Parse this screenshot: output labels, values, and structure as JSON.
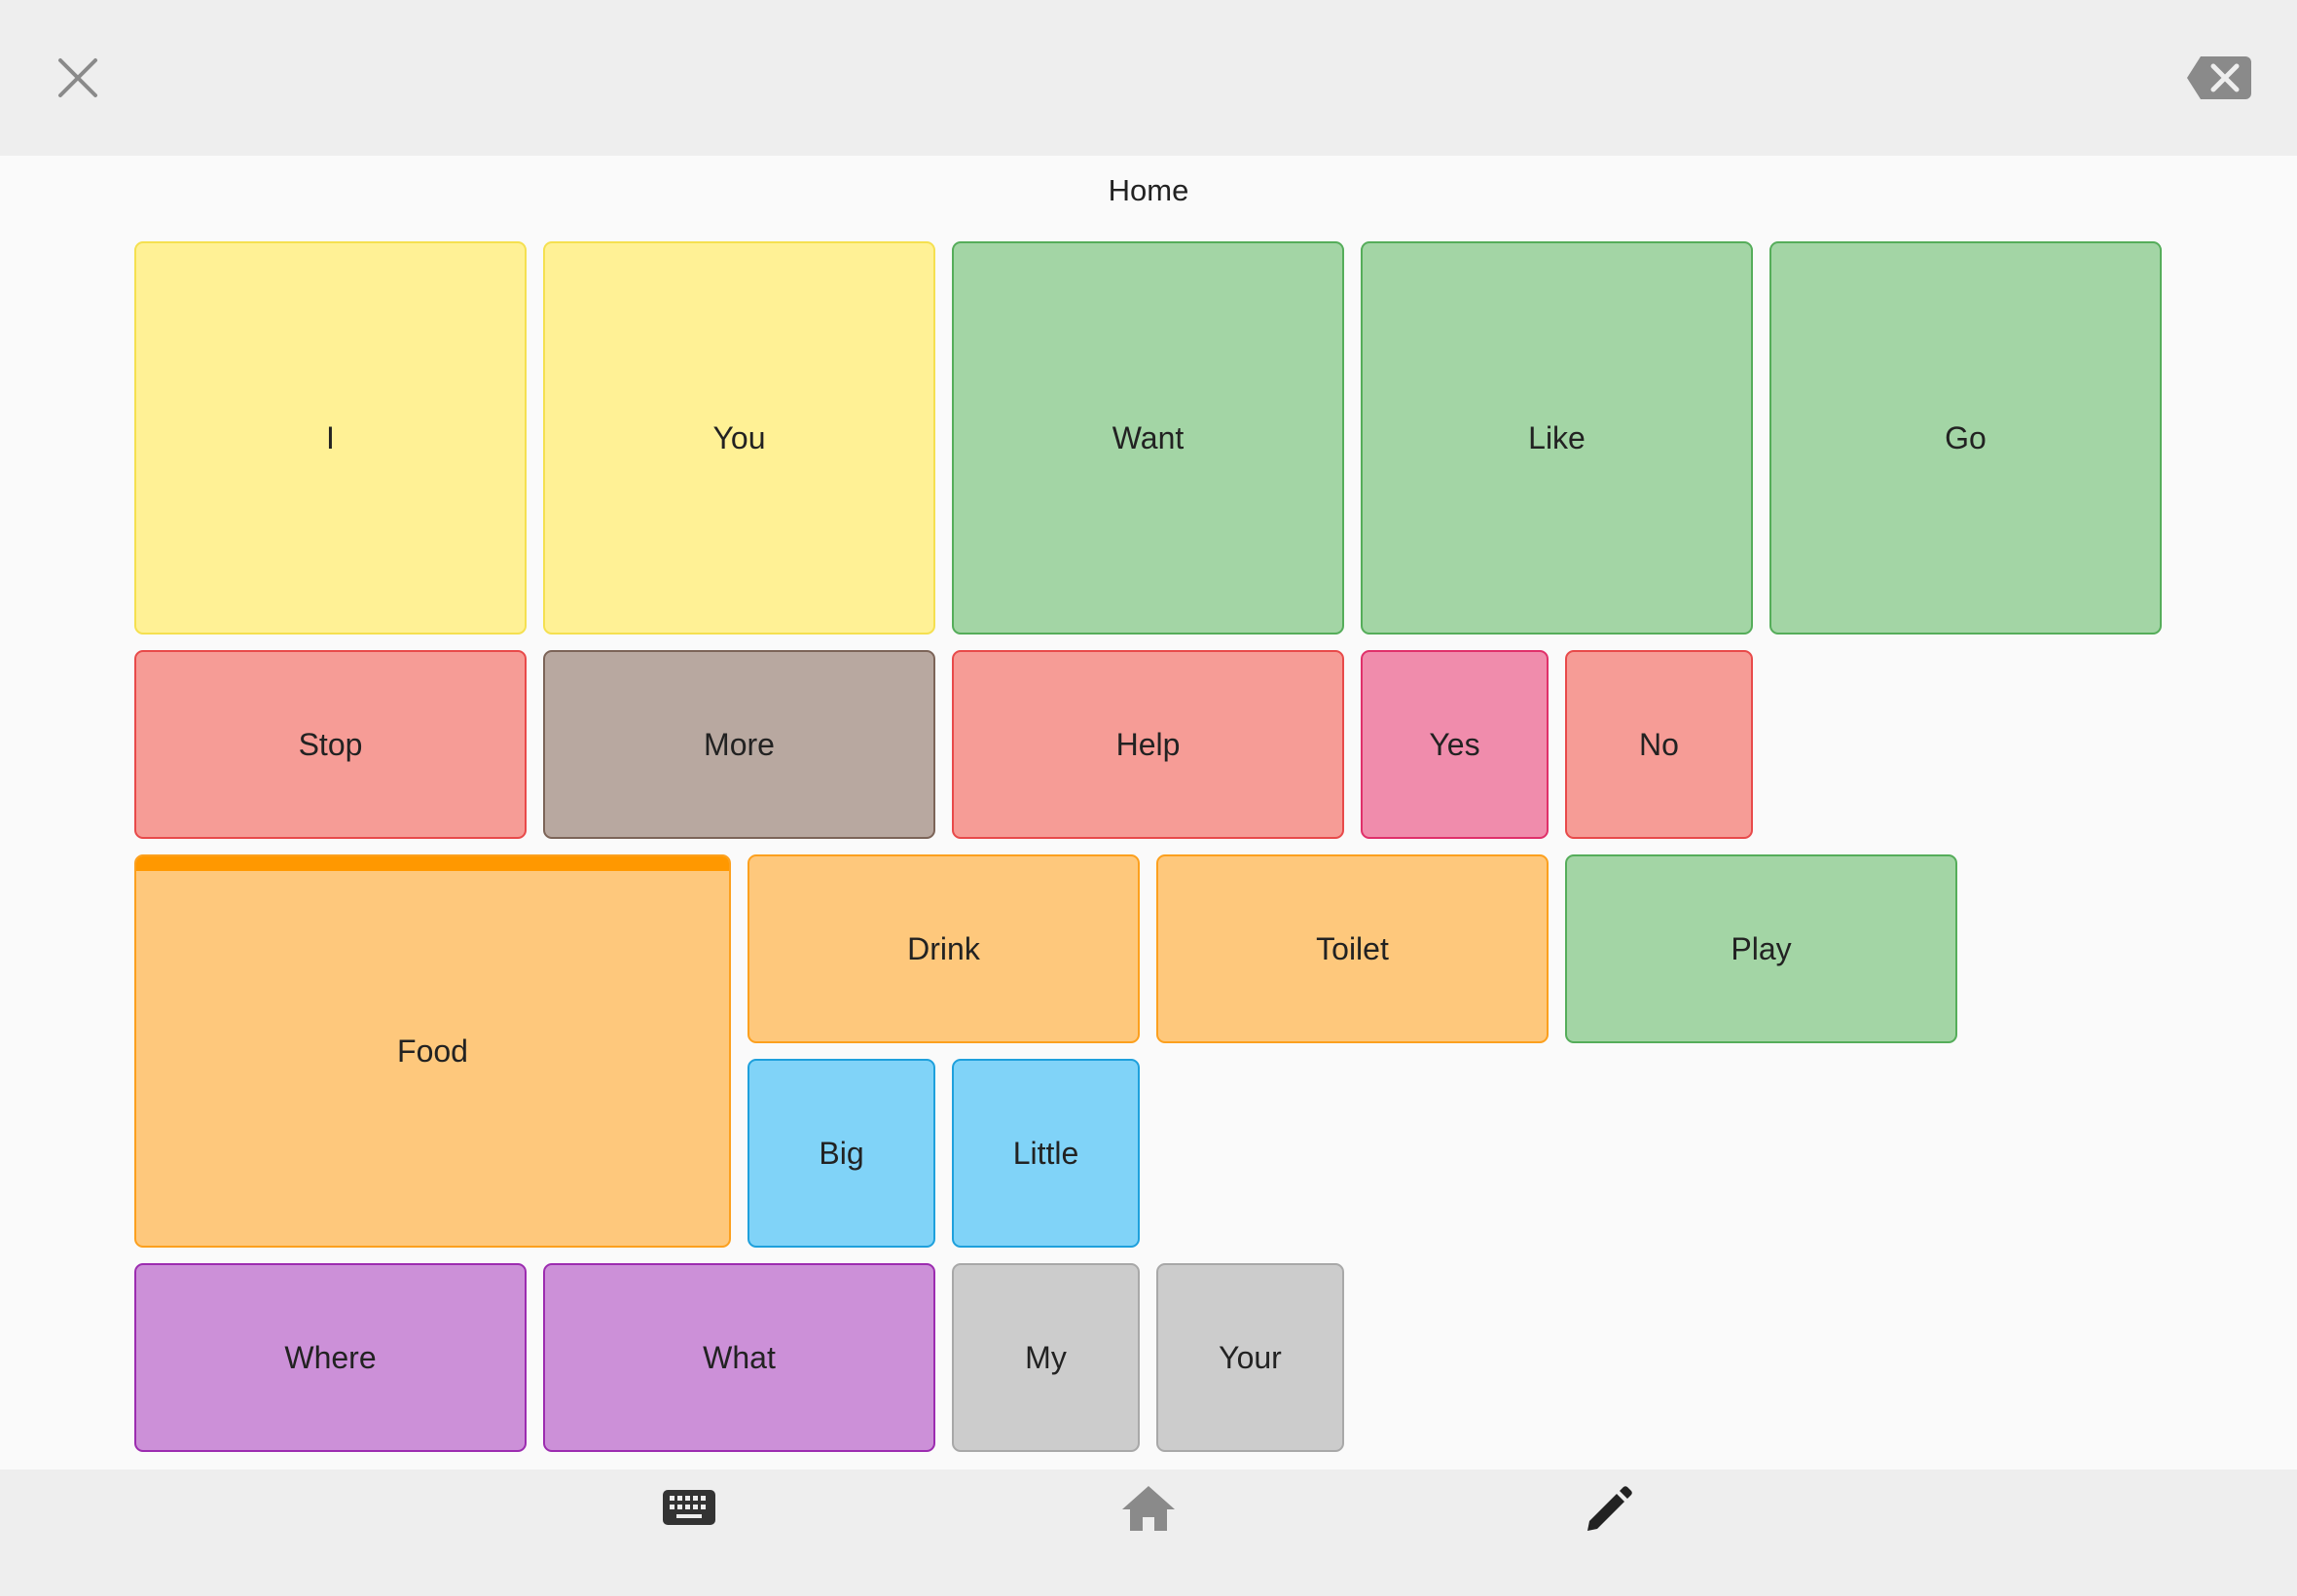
{
  "board": {
    "title": "Home"
  },
  "toolbar": {
    "close_icon": "close-icon",
    "backspace_icon": "backspace-icon"
  },
  "tiles": {
    "i": {
      "label": "I",
      "color": "#fff195"
    },
    "you": {
      "label": "You",
      "color": "#fff195"
    },
    "want": {
      "label": "Want",
      "color": "#a3d5a5"
    },
    "like": {
      "label": "Like",
      "color": "#a3d5a5"
    },
    "go": {
      "label": "Go",
      "color": "#a3d5a5"
    },
    "stop": {
      "label": "Stop",
      "color": "#f69c96"
    },
    "more": {
      "label": "More",
      "color": "#b8a8a0"
    },
    "help": {
      "label": "Help",
      "color": "#f69c96"
    },
    "yes": {
      "label": "Yes",
      "color": "#f08cac"
    },
    "no": {
      "label": "No",
      "color": "#f69c96"
    },
    "food": {
      "label": "Food",
      "color": "#fec87c",
      "folder": true
    },
    "drink": {
      "label": "Drink",
      "color": "#fec87c"
    },
    "toilet": {
      "label": "Toilet",
      "color": "#fec87c"
    },
    "play": {
      "label": "Play",
      "color": "#a3d5a5"
    },
    "big": {
      "label": "Big",
      "color": "#80d3f8"
    },
    "little": {
      "label": "Little",
      "color": "#80d3f8"
    },
    "where": {
      "label": "Where",
      "color": "#cc90d8"
    },
    "what": {
      "label": "What",
      "color": "#cc90d8"
    },
    "my": {
      "label": "My",
      "color": "#cccccc"
    },
    "your": {
      "label": "Your",
      "color": "#cccccc"
    }
  },
  "bottom_nav": {
    "keyboard_icon": "keyboard-icon",
    "home_icon": "home-icon",
    "edit_icon": "pencil-icon"
  }
}
